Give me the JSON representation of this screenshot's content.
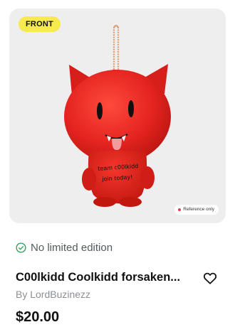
{
  "card": {
    "image_badge": "FRONT",
    "reference_note": "Reference only",
    "product_print_line1": "team c00lkidd",
    "product_print_line2": "join today!",
    "edition_label": "No limited edition",
    "title": "C00lkidd Coolkidd forsaken...",
    "creator": "By LordBuzinezz",
    "price": "$20.00",
    "icons": {
      "edition": "check-circle-icon",
      "favorite": "heart-icon"
    }
  },
  "colors": {
    "badge_bg": "#f7ea4f",
    "image_bg": "#eeeeee",
    "plush_red": "#e3231f",
    "check_green": "#2e9d56"
  }
}
